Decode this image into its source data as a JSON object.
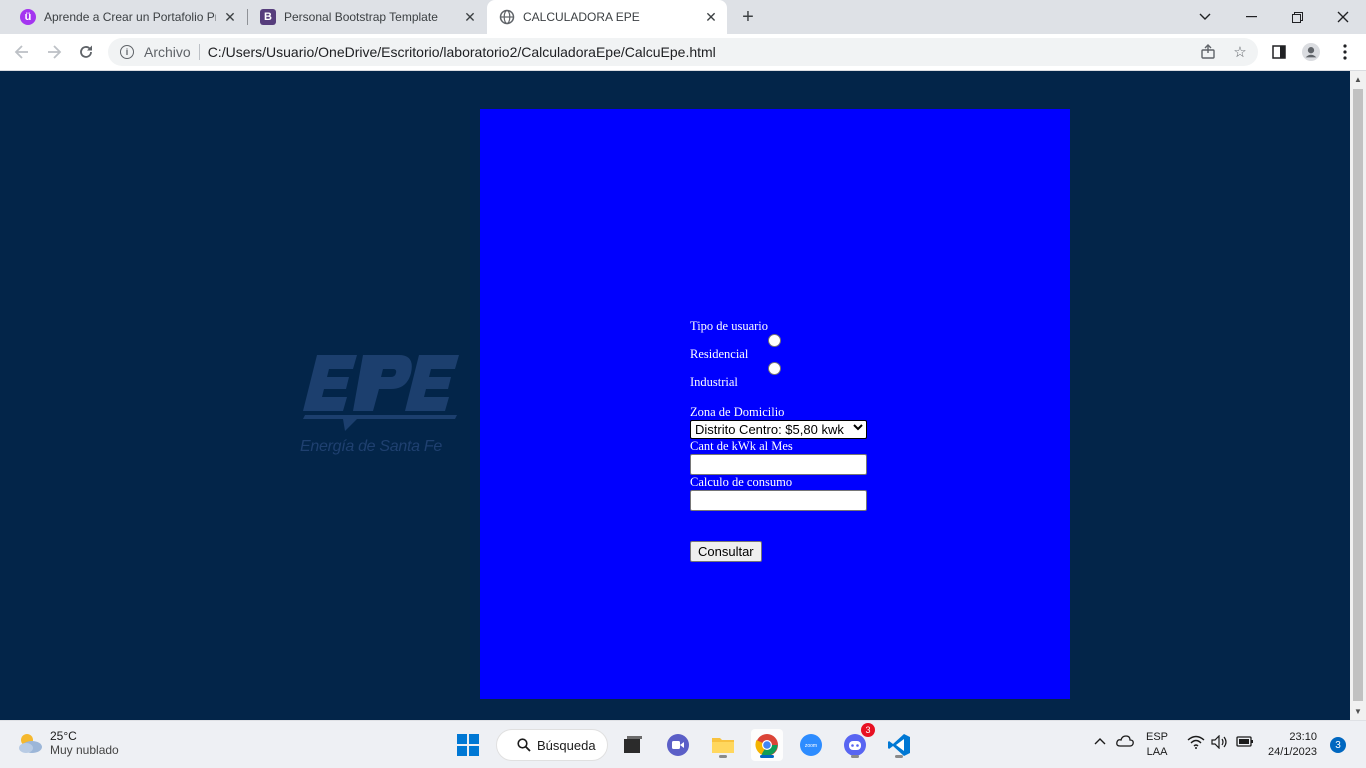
{
  "browser": {
    "tabs": [
      {
        "title": "Aprende a Crear un Portafolio Pr",
        "favicon_color": "#a435f0",
        "favicon_glyph": "ü"
      },
      {
        "title": "Personal Bootstrap Template",
        "favicon_color": "#563d7c",
        "favicon_glyph": "B"
      },
      {
        "title": "CALCULADORA EPE",
        "favicon_color": "#5f6368",
        "favicon_glyph": "globe-icon",
        "active": true
      }
    ],
    "address": {
      "scheme_label": "Archivo",
      "url": "C:/Users/Usuario/OneDrive/Escritorio/laboratorio2/CalculadoraEpe/CalcuEpe.html"
    }
  },
  "page": {
    "background_color": "#032549",
    "panel_color": "#0000ff",
    "logo": {
      "name": "EPE",
      "tagline": "Energía de Santa Fe"
    },
    "form": {
      "tipo_label": "Tipo de usuario",
      "options": [
        "Residencial",
        "Industrial"
      ],
      "zona_label": "Zona de Domicilio",
      "zona_selected": "Distrito Centro: $5,80 kwk",
      "kwh_label": "Cant de kWk al Mes",
      "kwh_value": "",
      "calculo_label": "Calculo de consumo",
      "calculo_value": "",
      "submit_label": "Consultar"
    }
  },
  "taskbar": {
    "weather": {
      "temp": "25°C",
      "condition": "Muy nublado"
    },
    "search_label": "Búsqueda",
    "apps": [
      "start-icon",
      "search",
      "file-explorer-dark-icon",
      "meet-icon",
      "folder-icon",
      "chrome-icon",
      "zoom-icon",
      "discord-icon",
      "vscode-icon"
    ],
    "discord_badge": "3",
    "language": {
      "line1": "ESP",
      "line2": "LAA"
    },
    "clock": {
      "time": "23:10",
      "date": "24/1/2023"
    },
    "notifications": "3"
  }
}
